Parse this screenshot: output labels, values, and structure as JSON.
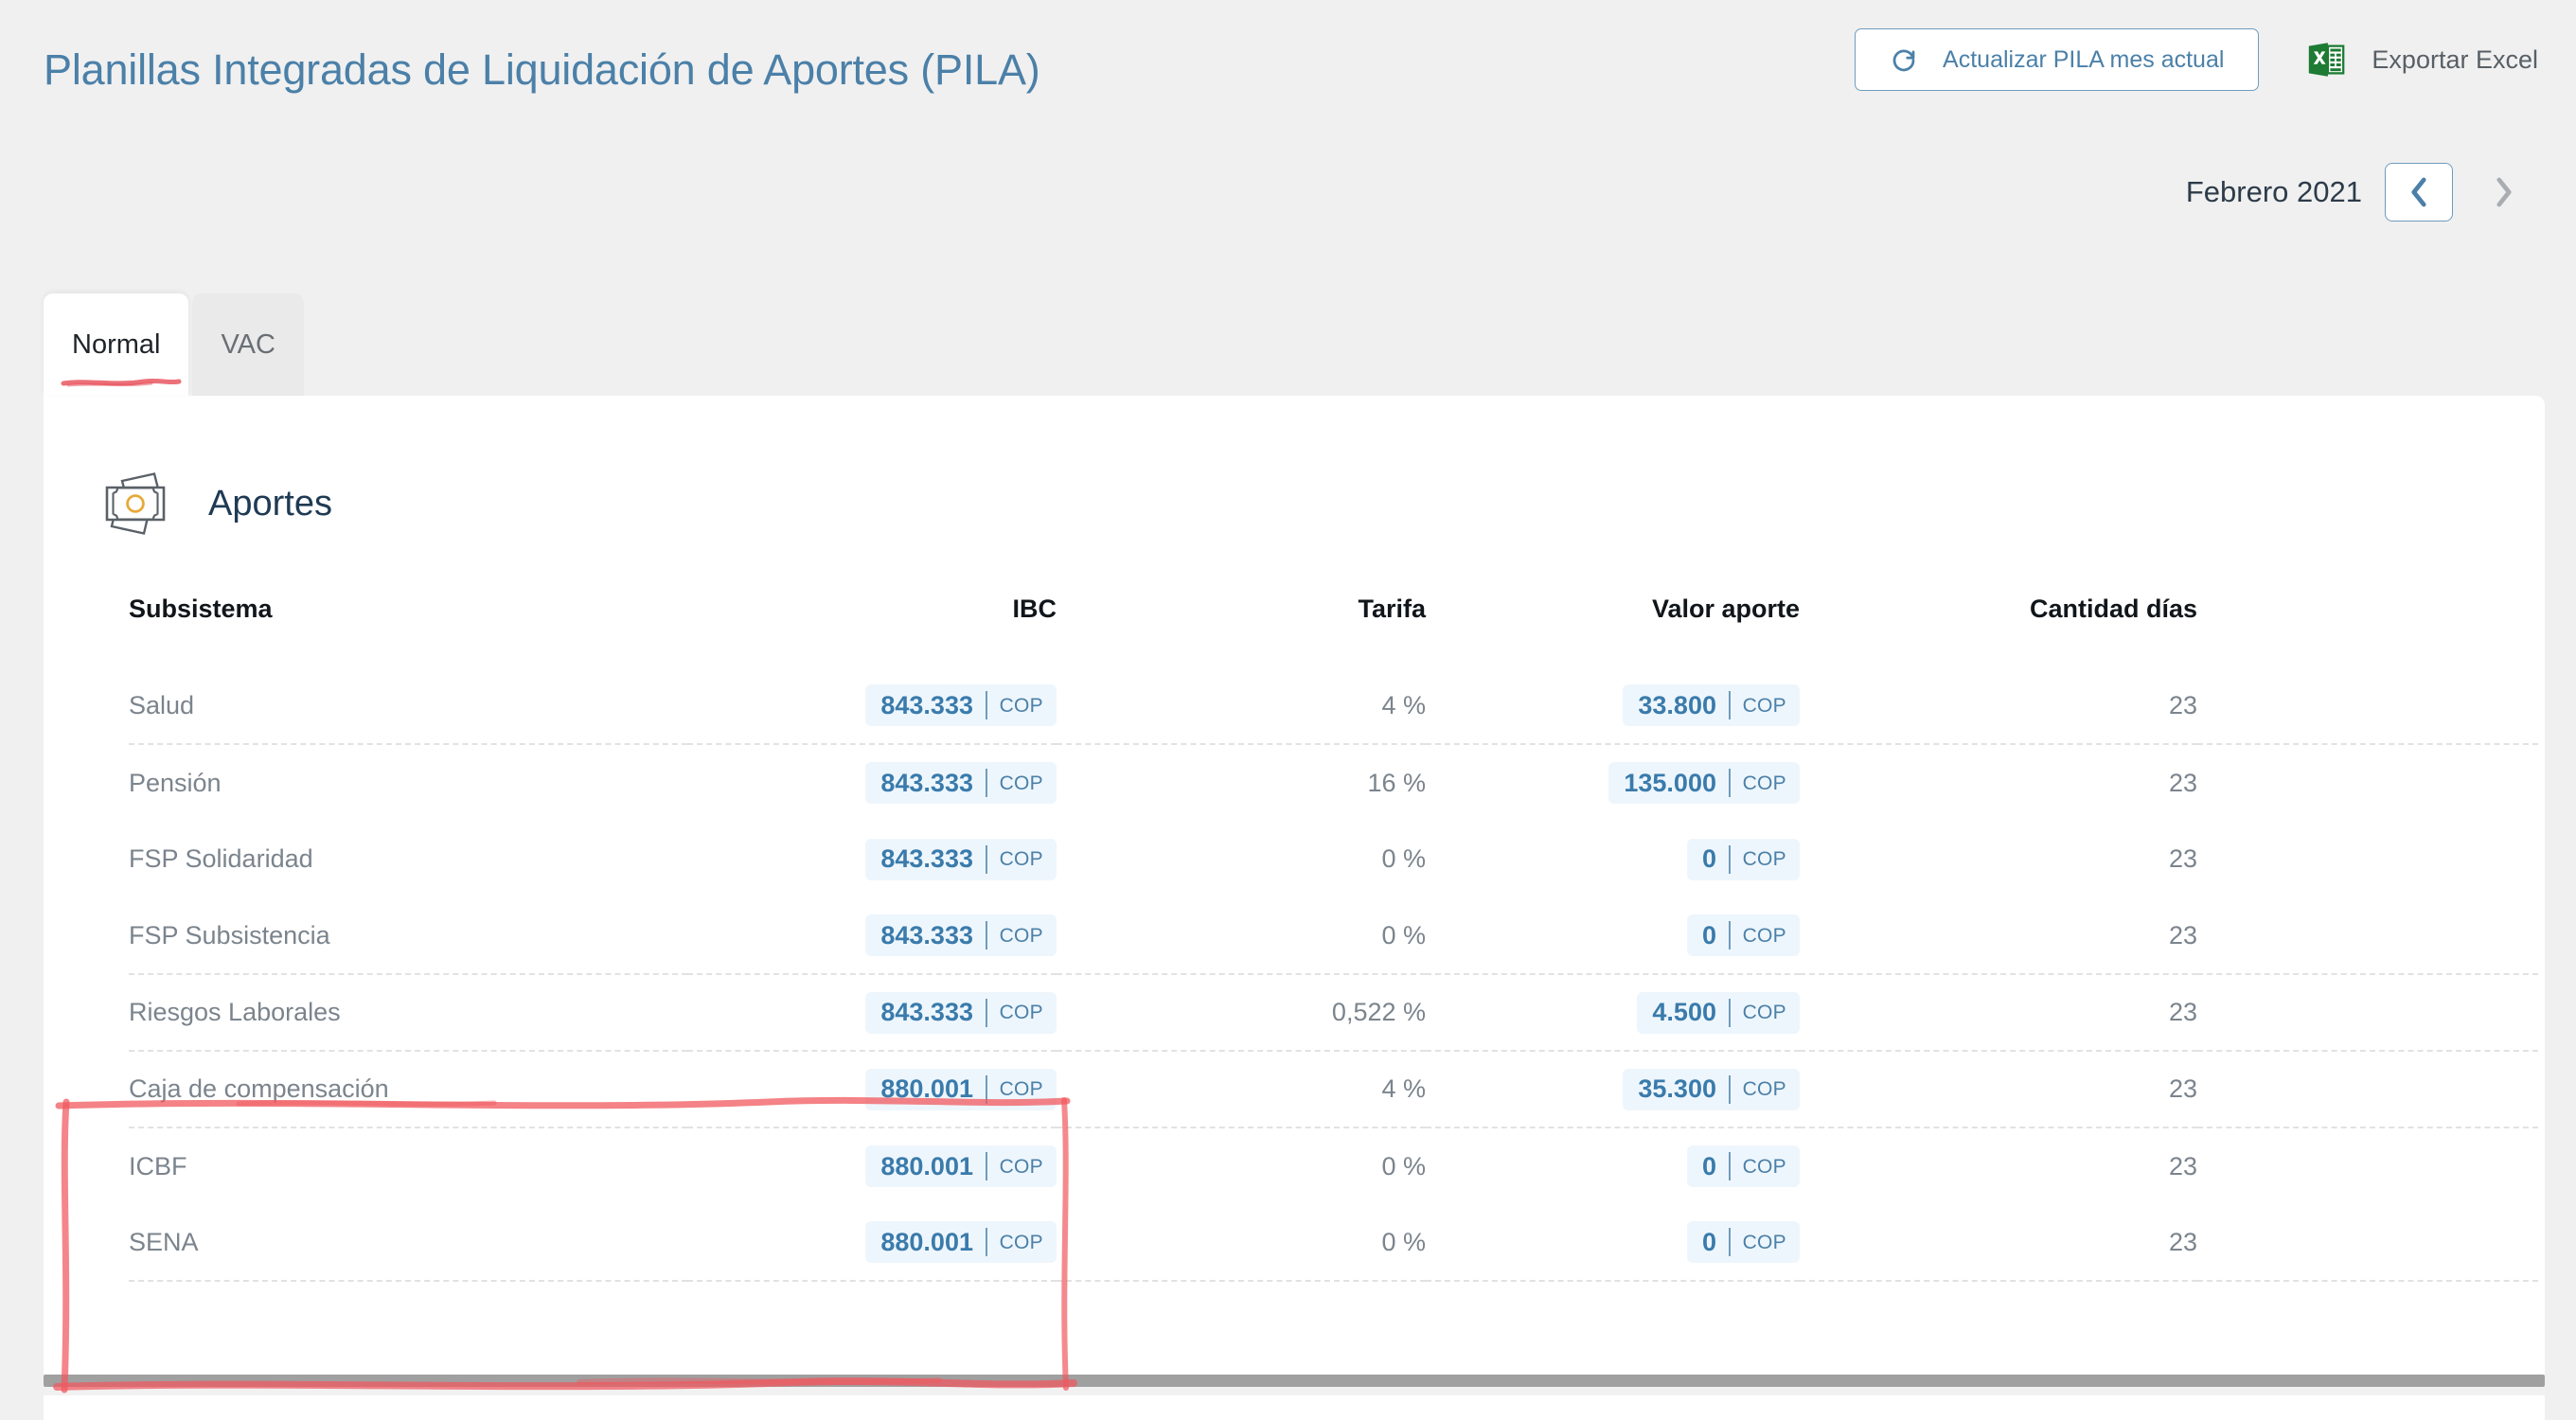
{
  "header": {
    "title": "Planillas Integradas de Liquidación de Aportes (PILA)",
    "refresh_button_label": "Actualizar PILA mes actual",
    "refresh_icon": "refresh-icon",
    "export_label": "Exportar Excel",
    "export_icon": "excel-icon",
    "title_color": "#4b80a8"
  },
  "month_nav": {
    "label": "Febrero 2021",
    "prev_icon": "chevron-left-icon",
    "next_icon": "chevron-right-icon",
    "prev_enabled": true,
    "next_enabled": false
  },
  "tabs": [
    {
      "label": "Normal",
      "active": true
    },
    {
      "label": "VAC",
      "active": false
    }
  ],
  "section": {
    "title": "Aportes",
    "icon": "money-bill-icon"
  },
  "table": {
    "columns": [
      {
        "key": "subsistema",
        "label": "Subsistema",
        "align": "left"
      },
      {
        "key": "ibc",
        "label": "IBC",
        "align": "right"
      },
      {
        "key": "tarifa",
        "label": "Tarifa",
        "align": "right"
      },
      {
        "key": "valor_aporte",
        "label": "Valor aporte",
        "align": "right"
      },
      {
        "key": "cantidad_dias",
        "label": "Cantidad días",
        "align": "right"
      }
    ],
    "currency": "COP",
    "rows": [
      {
        "subsistema": "Salud",
        "ibc": "843.333",
        "tarifa": "4 %",
        "valor_aporte": "33.800",
        "cantidad_dias": "23",
        "divider_below": true,
        "highlighted": false
      },
      {
        "subsistema": "Pensión",
        "ibc": "843.333",
        "tarifa": "16 %",
        "valor_aporte": "135.000",
        "cantidad_dias": "23",
        "divider_below": false,
        "highlighted": false
      },
      {
        "subsistema": "FSP Solidaridad",
        "ibc": "843.333",
        "tarifa": "0 %",
        "valor_aporte": "0",
        "cantidad_dias": "23",
        "divider_below": false,
        "highlighted": false
      },
      {
        "subsistema": "FSP Subsistencia",
        "ibc": "843.333",
        "tarifa": "0 %",
        "valor_aporte": "0",
        "cantidad_dias": "23",
        "divider_below": true,
        "highlighted": false
      },
      {
        "subsistema": "Riesgos Laborales",
        "ibc": "843.333",
        "tarifa": "0,522 %",
        "valor_aporte": "4.500",
        "cantidad_dias": "23",
        "divider_below": true,
        "highlighted": false
      },
      {
        "subsistema": "Caja de compensación",
        "ibc": "880.001",
        "tarifa": "4 %",
        "valor_aporte": "35.300",
        "cantidad_dias": "23",
        "divider_below": true,
        "highlighted": true
      },
      {
        "subsistema": "ICBF",
        "ibc": "880.001",
        "tarifa": "0 %",
        "valor_aporte": "0",
        "cantidad_dias": "23",
        "divider_below": false,
        "highlighted": true
      },
      {
        "subsistema": "SENA",
        "ibc": "880.001",
        "tarifa": "0 %",
        "valor_aporte": "0",
        "cantidad_dias": "23",
        "divider_below": true,
        "highlighted": true
      }
    ]
  },
  "annotations": {
    "tab_underline_color": "#e8505b",
    "highlight_box_color": "#f0585e"
  },
  "colors": {
    "page_background": "#f0f0f0",
    "card_background": "#ffffff",
    "accent_blue": "#4b80a8",
    "badge_background": "#eef6fd",
    "excel_green": "#1d7b33"
  }
}
